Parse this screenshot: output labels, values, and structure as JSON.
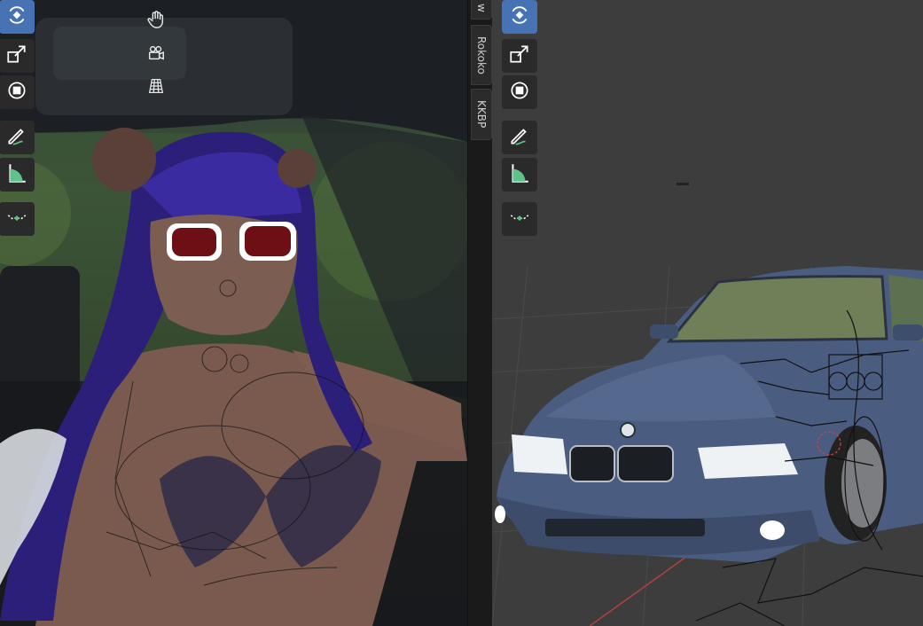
{
  "sidebar_tabs": {
    "partial": "w",
    "rokoko": "Rokoko",
    "kkbp": "KKBP"
  },
  "left_toolbar": [
    {
      "icon": "rotate-icon",
      "active": true
    },
    {
      "icon": "scale-icon",
      "active": false
    },
    {
      "icon": "transform-icon",
      "active": false
    },
    {
      "icon": "annotate-icon",
      "active": false
    },
    {
      "icon": "measure-icon",
      "active": false
    },
    {
      "icon": "curve-icon",
      "active": false
    }
  ],
  "nav_gizmo": [
    "pan-hand-icon",
    "camera-view-icon",
    "ortho-grid-icon"
  ],
  "colors": {
    "active_tool": "#4772b3",
    "tool_bg": "#2a2a2a",
    "right_bg": "#3d3d3d",
    "car_paint": "#4a5d80",
    "hair": "#2b1f7a"
  }
}
